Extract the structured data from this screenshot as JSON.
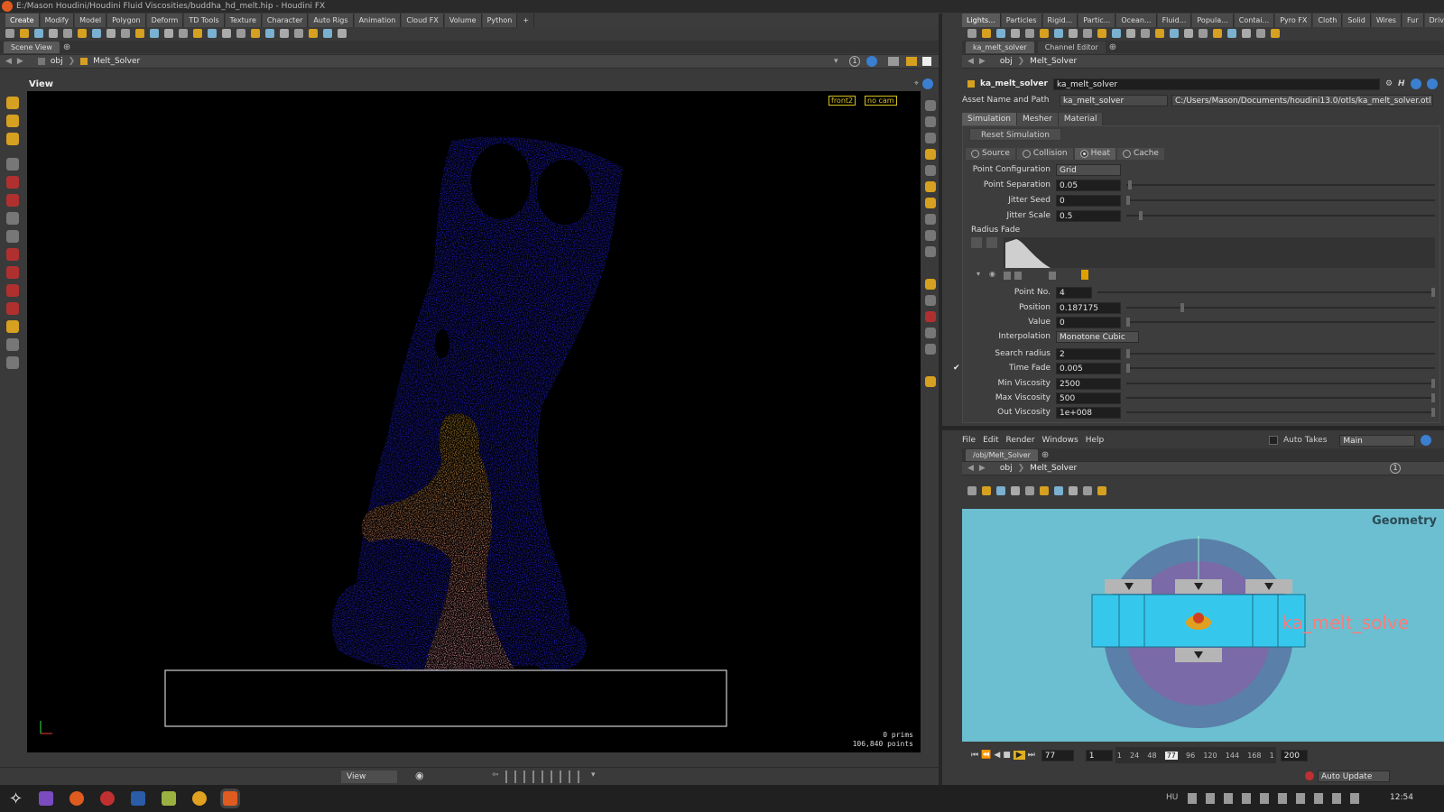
{
  "window": {
    "title": "E:/Mason Houdini/Houdini Fluid Viscosities/buddha_hd_melt.hip - Houdini FX"
  },
  "left_shelf": {
    "tabs": [
      "Create",
      "Modify",
      "Model",
      "Polygon",
      "Deform",
      "TD Tools",
      "Texture",
      "Character",
      "Auto Rigs",
      "Animation",
      "Cloud FX",
      "Volume",
      "Python"
    ],
    "add_label": "+"
  },
  "right_shelf": {
    "tabs": [
      "Lights...",
      "Particles",
      "Rigid...",
      "Partic...",
      "Ocean...",
      "Fluid...",
      "Popula...",
      "Contai...",
      "Pyro FX",
      "Cloth",
      "Solid",
      "Wires",
      "Fur",
      "Drive..."
    ]
  },
  "scene_view": {
    "tab_label": "Scene View",
    "path": [
      "obj",
      "Melt_Solver"
    ],
    "view_label": "View",
    "cam_front": "front2",
    "cam_nocam": "no cam",
    "stats_prims": "0  prims",
    "stats_points": "106,840 points",
    "bottom_view_dropdown": "View",
    "circle_1": "1"
  },
  "param_panel": {
    "tabs": [
      "ka_melt_solver",
      "Channel Editor"
    ],
    "path": [
      "obj",
      "Melt_Solver"
    ],
    "node_type": "ka_melt_solver",
    "node_name": "ka_melt_solver",
    "asset_label": "Asset Name and Path",
    "asset_name": "ka_melt_solver",
    "asset_path": "C:/Users/Mason/Documents/houdini13.0/otls/ka_melt_solver.otl",
    "subtabs": [
      "Simulation",
      "Mesher",
      "Material"
    ],
    "reset_button": "Reset Simulation",
    "modes": [
      {
        "label": "Source",
        "selected": false
      },
      {
        "label": "Collision",
        "selected": false
      },
      {
        "label": "Heat",
        "selected": true
      },
      {
        "label": "Cache",
        "selected": false
      }
    ],
    "point_configuration": {
      "label": "Point Configuration",
      "value": "Grid"
    },
    "point_separation": {
      "label": "Point Separation",
      "value": "0.05"
    },
    "jitter_seed": {
      "label": "Jitter Seed",
      "value": "0"
    },
    "jitter_scale": {
      "label": "Jitter Scale",
      "value": "0.5"
    },
    "radius_fade_label": "Radius Fade",
    "point_no": {
      "label": "Point No.",
      "value": "4"
    },
    "position": {
      "label": "Position",
      "value": "0.187175"
    },
    "value": {
      "label": "Value",
      "value": "0"
    },
    "interpolation": {
      "label": "Interpolation",
      "value": "Monotone Cubic"
    },
    "search_radius": {
      "label": "Search radius",
      "value": "2"
    },
    "time_fade": {
      "label": "Time Fade",
      "value": "0.005",
      "checked": true
    },
    "min_viscosity": {
      "label": "Min Viscosity",
      "value": "2500"
    },
    "max_viscosity": {
      "label": "Max Viscosity",
      "value": "500"
    },
    "out_viscosity": {
      "label": "Out Viscosity",
      "value": "1e+008"
    }
  },
  "network_panel": {
    "menu": [
      "File",
      "Edit",
      "Render",
      "Windows",
      "Help"
    ],
    "auto_takes_label": "Auto Takes",
    "take": "Main",
    "tab_label": "/obj/Melt_Solver",
    "path": [
      "obj",
      "Melt_Solver"
    ],
    "context_label": "Geometry",
    "node_label": "ka_melt_solve",
    "circle_1": "1"
  },
  "timeline": {
    "current_frame": "77",
    "start_frame": "1",
    "end_frame": "200",
    "ticks": [
      "1",
      "24",
      "48",
      "77",
      "96",
      "120",
      "144",
      "168",
      "1"
    ],
    "auto_update": "Auto Update"
  },
  "taskbar": {
    "lang": "HU",
    "clock": "12:54"
  },
  "colors": {
    "accent": "#3a7fd0",
    "node_blue": "#36c8ec",
    "node_label_pink": "#ff7a7a",
    "particle_blue": "#2222ee",
    "particle_orange": "#e0a040"
  }
}
